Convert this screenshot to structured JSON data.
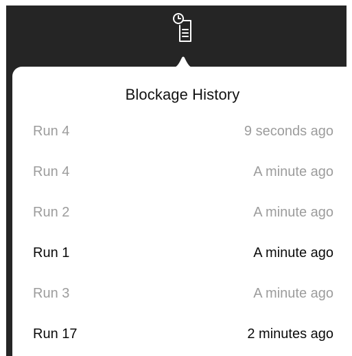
{
  "toolbar": {
    "history_icon": "clock-document-icon",
    "background_color": "#252525"
  },
  "popover": {
    "title": "Blockage History",
    "rows": [
      {
        "run": "Run 4",
        "time": "9 seconds ago",
        "state": "dim"
      },
      {
        "run": "Run 4",
        "time": "A minute ago",
        "state": "dim"
      },
      {
        "run": "Run 2",
        "time": "A minute ago",
        "state": "dim"
      },
      {
        "run": "Run 1",
        "time": "A minute ago",
        "state": "active"
      },
      {
        "run": "Run 3",
        "time": "A minute ago",
        "state": "dim"
      },
      {
        "run": "Run 17",
        "time": "2 minutes ago",
        "state": "active"
      }
    ]
  },
  "colors": {
    "dim_text": "#9c9c9c",
    "active_text": "#0b0b0b",
    "popover_bg": "#ffffff"
  }
}
